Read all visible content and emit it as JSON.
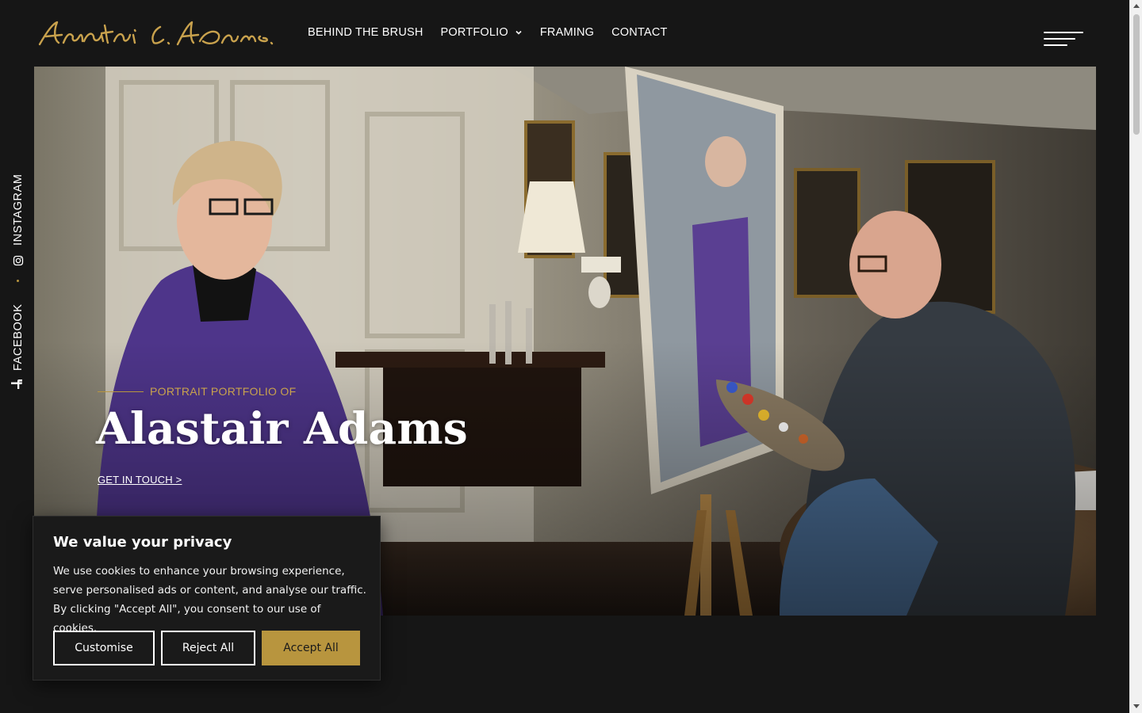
{
  "brand": {
    "logo_alt": "Alastair C. Adams",
    "accent_color": "#b8953e",
    "background_color": "#161616"
  },
  "nav": {
    "items": [
      {
        "label": "BEHIND THE BRUSH"
      },
      {
        "label": "PORTFOLIO",
        "has_dropdown": true
      },
      {
        "label": "FRAMING"
      },
      {
        "label": "CONTACT"
      }
    ],
    "menu_icon": "hamburger-icon"
  },
  "social": {
    "instagram": {
      "label": "INSTAGRAM",
      "icon": "instagram-icon"
    },
    "facebook": {
      "label": "FACEBOOK",
      "icon": "facebook-icon"
    }
  },
  "hero": {
    "kicker": "PORTRAIT PORTFOLIO OF",
    "title": "Alastair Adams",
    "cta": "GET IN TOUCH >"
  },
  "cookie": {
    "title": "We value your privacy",
    "body": "We use cookies to enhance your browsing experience, serve personalised ads or content, and analyse our traffic. By clicking \"Accept All\", you consent to our use of cookies.",
    "customise_label": "Customise",
    "reject_label": "Reject All",
    "accept_label": "Accept All",
    "accept_color": "#b8953e"
  }
}
